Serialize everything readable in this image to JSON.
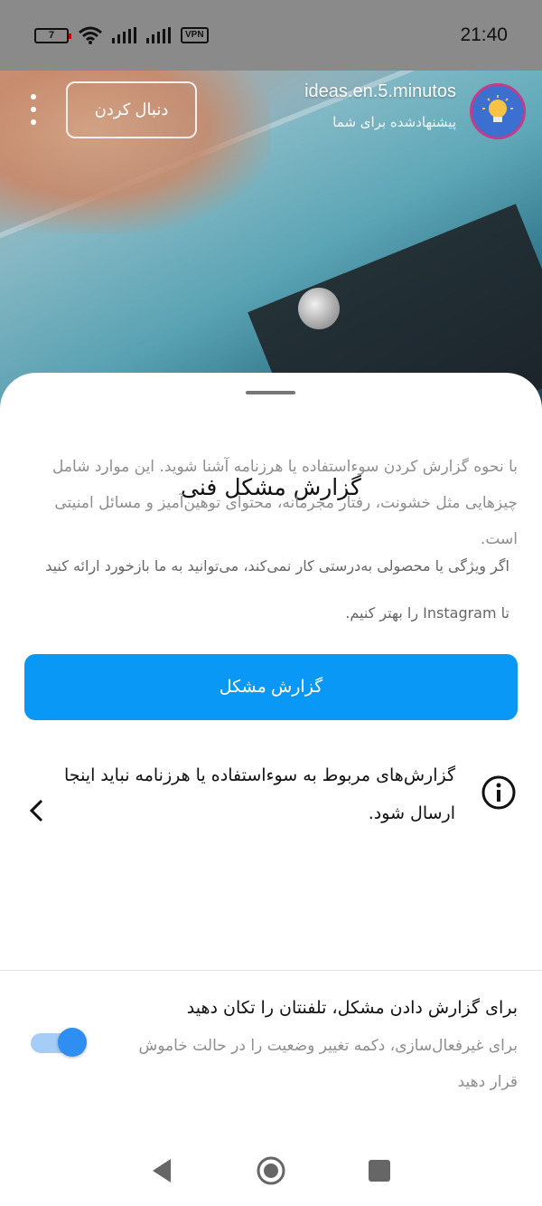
{
  "status_bar": {
    "battery": "7",
    "vpn": "VPN",
    "time": "21:40"
  },
  "video": {
    "account_name": "ideas.en.5.minutos",
    "account_sub": "پیشنهادشده برای شما",
    "follow_label": "دنبال کردن",
    "avatar_icon": "lightbulb-icon"
  },
  "sheet": {
    "title": "گزارش مشکل فنی",
    "description": "اگر ویژگی یا محصولی به‌درستی کار نمی‌کند، می‌توانید به ما بازخورد ارائه کنید تا Instagram را بهتر کنیم.",
    "report_button": "گزارش مشکل",
    "abuse_title": "گزارش‌های مربوط به سوءاستفاده یا هرزنامه نباید اینجا ارسال شود.",
    "abuse_desc": "با نحوه گزارش کردن سوءاستفاده یا هرزنامه آشنا شوید. این موارد شامل چیزهایی مثل خشونت، رفتار مجرمانه، محتوای توهین‌آمیز و مسائل امنیتی است.",
    "shake_title": "برای گزارش دادن مشکل، تلفنتان را تکان دهید",
    "shake_desc": "برای غیرفعال‌سازی، دکمه تغییر وضعیت را در حالت خاموش قرار دهید",
    "shake_toggle_on": true
  },
  "colors": {
    "accent": "#0a98f6",
    "toggle_thumb": "#2f8ef1",
    "toggle_track": "#a6cdf7"
  }
}
